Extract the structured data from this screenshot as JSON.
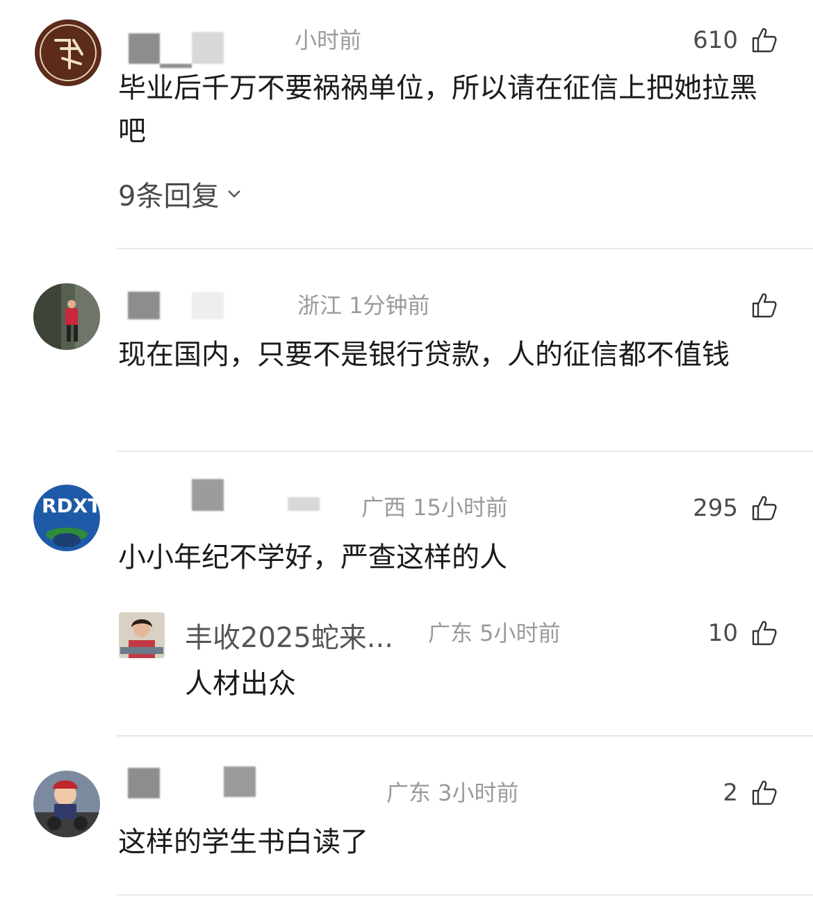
{
  "comments": [
    {
      "meta": "小时前",
      "likes": "610",
      "text": "毕业后千万不要祸祸单位，所以请在征信上把她拉黑吧",
      "replies_label": "9条回复"
    },
    {
      "meta": "浙江 1分钟前",
      "likes": "",
      "text": "现在国内，只要不是银行贷款，人的征信都不值钱"
    },
    {
      "meta": "广西 15小时前",
      "likes": "295",
      "text": "小小年纪不学好，严查这样的人",
      "avatar_text": "RDXT",
      "reply": {
        "name": "丰收2025蛇来...",
        "meta": "广东 5小时前",
        "likes": "10",
        "text": "人材出众"
      }
    },
    {
      "meta": "广东 3小时前",
      "likes": "2",
      "text": "这样的学生书白读了"
    }
  ],
  "icons": {
    "like": "thumbs-up-icon",
    "expand": "chevron-down-icon"
  },
  "colors": {
    "text": "#1a1a1a",
    "meta": "#9a9a9a",
    "divider": "#e6e6e6"
  }
}
